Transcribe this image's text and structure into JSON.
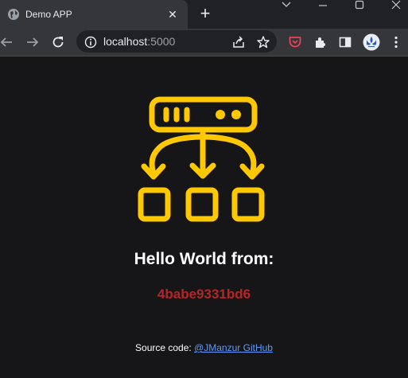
{
  "browser": {
    "tab": {
      "title": "Demo APP",
      "favicon": "globe-icon"
    },
    "address_bar": {
      "host": "localhost",
      "port": ":5000"
    },
    "toolbar_icons": [
      "back-icon",
      "forward-icon",
      "reload-icon",
      "site-info-icon",
      "share-icon",
      "bookmark-star-icon",
      "pocket-icon",
      "extensions-icon",
      "side-panel-icon",
      "profile-avatar"
    ]
  },
  "page": {
    "hero_icon": "server-hierarchy-icon",
    "greeting": "Hello World from:",
    "hostname": "4babe9331bd6",
    "footer": {
      "prefix": "Source code: ",
      "link_text": "@JManzur GitHub"
    }
  },
  "colors": {
    "background": "#161618",
    "accent": "#ffc800",
    "hostname": "#b3272b",
    "link": "#5b9bff"
  }
}
